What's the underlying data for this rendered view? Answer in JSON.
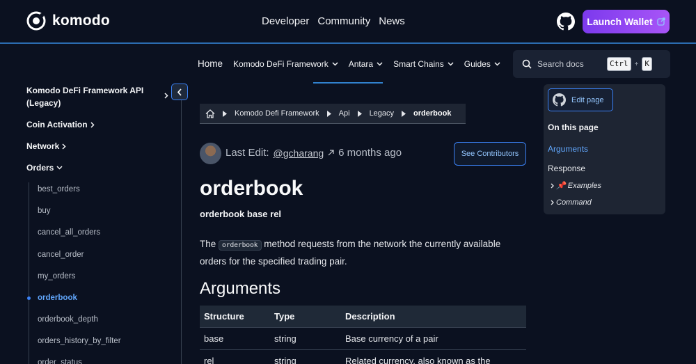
{
  "brand": {
    "name": "komodo"
  },
  "topnav": [
    "Developer",
    "Community",
    "News"
  ],
  "launch_label": "Launch Wallet",
  "subnav": [
    "Home",
    "Komodo DeFi Framework",
    "Antara",
    "Smart Chains",
    "Guides"
  ],
  "search": {
    "placeholder": "Search docs",
    "key1": "Ctrl",
    "plus": "+",
    "key2": "K"
  },
  "sidebar": {
    "title": "Komodo DeFi Framework API (Legacy)",
    "categories": [
      "Coin Activation",
      "Network",
      "Orders"
    ],
    "orders": [
      "best_orders",
      "buy",
      "cancel_all_orders",
      "cancel_order",
      "my_orders",
      "orderbook",
      "orderbook_depth",
      "orders_history_by_filter",
      "order_status"
    ]
  },
  "breadcrumbs": [
    "Komodo Defi Framework",
    "Api",
    "Legacy",
    "orderbook"
  ],
  "lastedit": {
    "label": "Last Edit:",
    "user": "@gcharang",
    "time": "6 months ago"
  },
  "contributors_label": "See Contributors",
  "page": {
    "title": "orderbook",
    "signature": "orderbook base rel",
    "intro_before": "The",
    "intro_code": "orderbook",
    "intro_after": "method requests from the network the currently available orders for the specified trading pair.",
    "section": "Arguments"
  },
  "table": {
    "headers": [
      "Structure",
      "Type",
      "Description"
    ],
    "rows": [
      [
        "base",
        "string",
        "Base currency of a pair"
      ],
      [
        "rel",
        "string",
        "Related currency, also known as the"
      ]
    ]
  },
  "toc": {
    "edit_label": "Edit page",
    "heading": "On this page",
    "items": [
      "Arguments",
      "Response"
    ],
    "subitems": [
      "📌 Examples",
      "Command"
    ]
  },
  "colors": {
    "accent": "#3b82f6",
    "launch_gradient_start": "#7c3aed",
    "launch_gradient_end": "#a855f7",
    "background": "#0b1120"
  }
}
